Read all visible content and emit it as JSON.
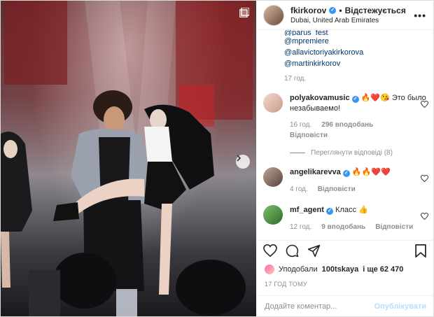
{
  "post": {
    "author": "fkirkorov",
    "follow_status": "Відстежується",
    "separator": "•",
    "location": "Dubai, United Arab Emirates",
    "more_label": "•••"
  },
  "caption": {
    "mentions": [
      "@parus_fest",
      "@mpremiere",
      "@allavictoriyakirkorova",
      "@martinkirkorov"
    ],
    "time": "17 год."
  },
  "comments": [
    {
      "user": "polyakovamusic",
      "text": "🔥❤️😘 Это было незабываемо!",
      "time": "16 год.",
      "likes": "296 вподобань",
      "reply": "Відповісти",
      "view_replies": "Переглянути відповіді (8)"
    },
    {
      "user": "angelikarevva",
      "text": "🔥🔥❤️❤️",
      "time": "4 год.",
      "reply": "Відповісти"
    },
    {
      "user": "mf_agent",
      "text": "Класс 👍",
      "time": "12 год.",
      "likes": "9 вподобань",
      "reply": "Відповісти"
    }
  ],
  "likes": {
    "prefix": "Уподобали",
    "user": "100tskaya",
    "suffix": "і ще 62 470"
  },
  "posted_time": "17 ГОД ТОМУ",
  "add_comment": {
    "placeholder": "Додайте коментар...",
    "publish_label": "Опублікувати"
  },
  "icons": [
    "heart-icon",
    "comment-icon",
    "share-icon",
    "bookmark-icon",
    "emoji-icon",
    "chevron-right-icon",
    "carousel-icon",
    "more-icon",
    "verified-icon"
  ],
  "colors": {
    "link": "#00376b",
    "verified": "#3897f0",
    "publish": "#b2dffc",
    "meta": "#8e8e8e"
  }
}
